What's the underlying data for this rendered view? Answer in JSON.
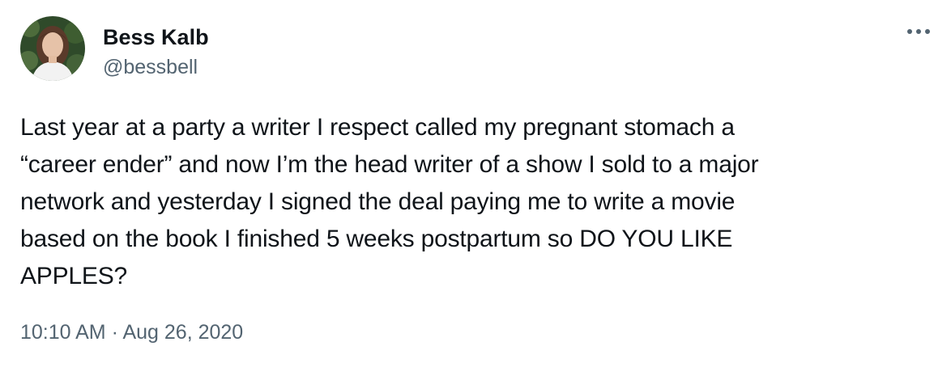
{
  "author": {
    "display_name": "Bess Kalb",
    "handle": "@bessbell"
  },
  "tweet": {
    "text": "Last year at a party a writer I respect called my pregnant stomach a\n“career ender” and now I’m the head writer of a show I sold to a major\nnetwork and yesterday I signed the deal paying me to write a movie\nbased on the book I finished 5 weeks postpartum so DO YOU LIKE\nAPPLES?",
    "timestamp": "10:10 AM · Aug 26, 2020"
  },
  "icons": {
    "more": "more-horizontal-icon",
    "avatar": "profile-photo"
  },
  "colors": {
    "text_primary": "#0f1419",
    "text_secondary": "#536471",
    "background": "#ffffff"
  }
}
